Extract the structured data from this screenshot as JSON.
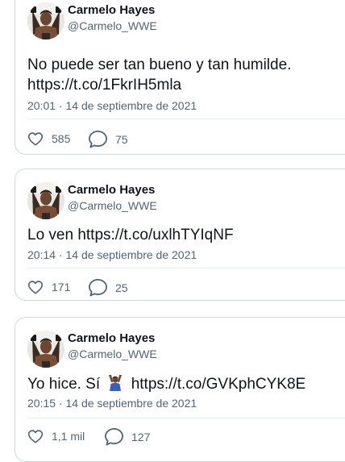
{
  "tweets": [
    {
      "author_name": "Carmelo Hayes",
      "author_handle": "@Carmelo_WWE",
      "text_line1": "No puede ser tan bueno y tan humilde.",
      "text_line2": "https://t.co/1FkrIH5mla",
      "timestamp": "20:01 · 14 de septiembre de 2021",
      "likes": "585",
      "replies": "75"
    },
    {
      "author_name": "Carmelo Hayes",
      "author_handle": "@Carmelo_WWE",
      "text_line1": "Lo ven https://t.co/uxlhTYIqNF",
      "timestamp": "20:14 · 14 de septiembre de 2021",
      "likes": "171",
      "replies": "25"
    },
    {
      "author_name": "Carmelo Hayes",
      "author_handle": "@Carmelo_WWE",
      "text_before_emoji": "Yo hice. Sí",
      "text_after_emoji": "https://t.co/GVKphCYK8E",
      "timestamp": "20:15 · 14 de septiembre de 2021",
      "likes": "1,1 mil",
      "replies": "127"
    }
  ],
  "icons": {
    "like": "heart-outline-icon",
    "reply": "speech-bubble-icon",
    "emoji": "person-raising-hands-emoji"
  },
  "colors": {
    "border": "#cfd9de",
    "text": "#0f1419",
    "secondary": "#536471"
  }
}
